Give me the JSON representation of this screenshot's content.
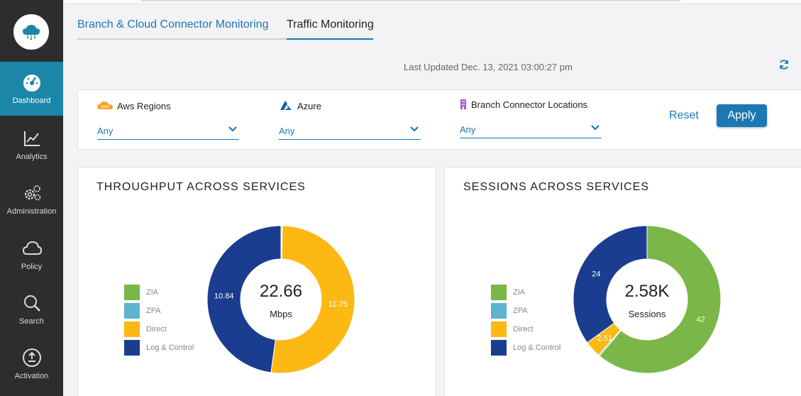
{
  "sidebar": {
    "items": [
      {
        "label": "Dashboard",
        "icon": "dashboard-gauge-icon",
        "active": true
      },
      {
        "label": "Analytics",
        "icon": "analytics-chart-icon"
      },
      {
        "label": "Administration",
        "icon": "gears-icon"
      },
      {
        "label": "Policy",
        "icon": "cloud-icon"
      },
      {
        "label": "Search",
        "icon": "search-icon"
      },
      {
        "label": "Activation",
        "icon": "upload-icon"
      }
    ]
  },
  "tabs": [
    {
      "label": "Branch & Cloud Connector Monitoring"
    },
    {
      "label": "Traffic Monitoring"
    }
  ],
  "status": {
    "last_updated": "Last Updated Dec. 13, 2021 03:00:27 pm"
  },
  "filters": [
    {
      "label": "Aws Regions",
      "value": "Any",
      "icon": "aws-icon"
    },
    {
      "label": "Azure",
      "value": "Any",
      "icon": "azure-icon"
    },
    {
      "label": "Branch Connector Locations",
      "value": "Any",
      "icon": "building-icon"
    }
  ],
  "actions": {
    "reset": "Reset",
    "apply": "Apply"
  },
  "colors": {
    "zia": "#7ab648",
    "zpa": "#5bb5cf",
    "direct": "#fdb813",
    "log_control": "#1a3d8f",
    "accent": "#1b78b4"
  },
  "chart_data": [
    {
      "type": "pie",
      "title": "THROUGHPUT ACROSS SERVICES",
      "center_value": "22.66",
      "center_unit": "Mbps",
      "labels": [
        "ZIA",
        "ZPA",
        "Direct",
        "Log & Control"
      ],
      "values": [
        0.05,
        0.02,
        11.75,
        10.84
      ],
      "data_labels": [
        "",
        "",
        "11.75",
        "10.84"
      ]
    },
    {
      "type": "pie",
      "title": "SESSIONS ACROSS SERVICES",
      "center_value": "2.58K",
      "center_unit": "Sessions",
      "labels": [
        "ZIA",
        "ZPA",
        "Direct",
        "Log & Control"
      ],
      "values": [
        42,
        0.2,
        2.51,
        24
      ],
      "data_labels": [
        "42",
        "",
        "2.51",
        "24"
      ]
    }
  ]
}
